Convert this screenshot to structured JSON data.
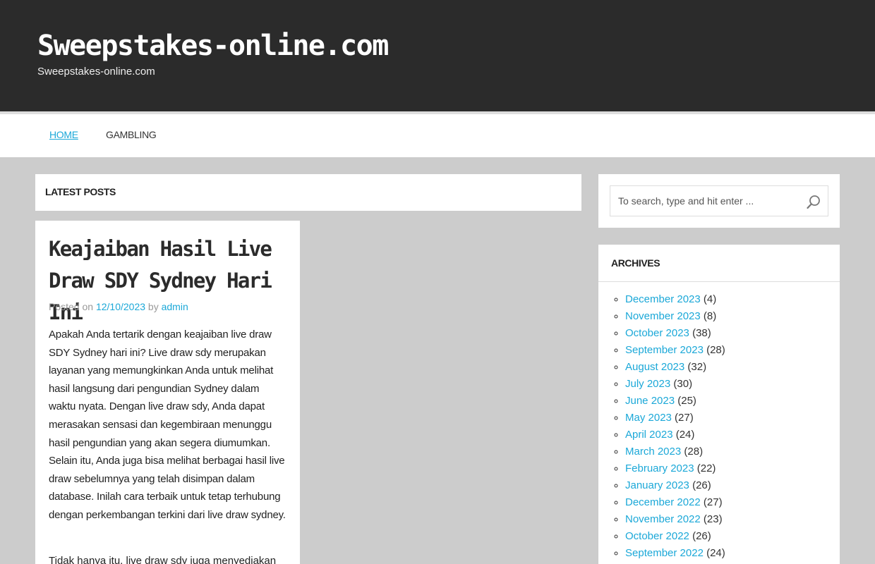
{
  "header": {
    "title": "Sweepstakes-online.com",
    "description": "Sweepstakes-online.com"
  },
  "nav": {
    "items": [
      {
        "label": "HOME",
        "active": true
      },
      {
        "label": "GAMBLING",
        "active": false
      }
    ]
  },
  "main": {
    "section_title": "LATEST POSTS",
    "post": {
      "title": "Keajaiban Hasil Live Draw SDY Sydney Hari Ini",
      "meta_posted": "Posted on",
      "date": "12/10/2023",
      "meta_by": "by",
      "author": "admin",
      "body": "Apakah Anda tertarik dengan keajaiban live draw SDY Sydney hari ini? Live draw sdy merupakan layanan yang memungkinkan Anda untuk melihat hasil langsung dari pengundian Sydney dalam waktu nyata. Dengan live draw sdy, Anda dapat merasakan sensasi dan kegembiraan menunggu hasil pengundian yang akan segera diumumkan. Selain itu, Anda juga bisa melihat berbagai hasil live draw sebelumnya yang telah disimpan dalam database. Inilah cara terbaik untuk tetap terhubung dengan perkembangan terkini dari live draw sydney.",
      "body_next": "Tidak hanya itu, live draw sdy juga menyediakan"
    }
  },
  "sidebar": {
    "search": {
      "placeholder": "To search, type and hit enter ...",
      "icon": "search-icon"
    },
    "archives": {
      "title": "ARCHIVES",
      "items": [
        {
          "label": "December 2023",
          "count": "(4)"
        },
        {
          "label": "November 2023",
          "count": "(8)"
        },
        {
          "label": "October 2023",
          "count": "(38)"
        },
        {
          "label": "September 2023",
          "count": "(28)"
        },
        {
          "label": "August 2023",
          "count": "(32)"
        },
        {
          "label": "July 2023",
          "count": "(30)"
        },
        {
          "label": "June 2023",
          "count": "(25)"
        },
        {
          "label": "May 2023",
          "count": "(27)"
        },
        {
          "label": "April 2023",
          "count": "(24)"
        },
        {
          "label": "March 2023",
          "count": "(28)"
        },
        {
          "label": "February 2023",
          "count": "(22)"
        },
        {
          "label": "January 2023",
          "count": "(26)"
        },
        {
          "label": "December 2022",
          "count": "(27)"
        },
        {
          "label": "November 2022",
          "count": "(23)"
        },
        {
          "label": "October 2022",
          "count": "(26)"
        },
        {
          "label": "September 2022",
          "count": "(24)"
        }
      ]
    }
  },
  "colors": {
    "header_bg": "#2b2b2b",
    "page_bg": "#cccccc",
    "accent": "#1ba8d8"
  }
}
